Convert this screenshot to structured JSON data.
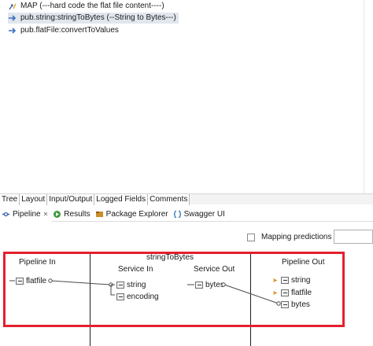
{
  "flow": {
    "steps": [
      {
        "label": "MAP (---hard code the flat file content----)",
        "icon": "map-icon"
      },
      {
        "label": "pub.string:stringToBytes (--String to Bytes---)",
        "icon": "invoke-arrow-icon"
      },
      {
        "label": "pub.flatFile:convertToValues",
        "icon": "invoke-arrow-icon"
      }
    ]
  },
  "editor_tabs": [
    "Tree",
    "Layout",
    "Input/Output",
    "Logged Fields",
    "Comments"
  ],
  "view_tabs": [
    {
      "label": "Pipeline",
      "icon": "pipeline-icon",
      "close": "✕"
    },
    {
      "label": "Results",
      "icon": "results-icon"
    },
    {
      "label": "Package Explorer",
      "icon": "package-icon"
    },
    {
      "label": "Swagger UI",
      "icon": "swagger-icon"
    }
  ],
  "toolbar": {
    "mapping_predictions": "Mapping predictions",
    "search_value": ""
  },
  "pipeline": {
    "service_name": "stringToBytes",
    "pipeline_in": {
      "header": "Pipeline In",
      "fields": [
        "flatfile"
      ]
    },
    "service_in": {
      "header": "Service In",
      "fields": [
        "string",
        "encoding"
      ]
    },
    "service_out": {
      "header": "Service Out",
      "fields": [
        "bytes"
      ]
    },
    "pipeline_out": {
      "header": "Pipeline Out",
      "fields": [
        "string",
        "flatfile",
        "bytes"
      ]
    }
  },
  "colors": {
    "highlight": "#e3202d",
    "selected_row": "#e1e6ee",
    "invoke_arrow": "#3b6fc2"
  }
}
